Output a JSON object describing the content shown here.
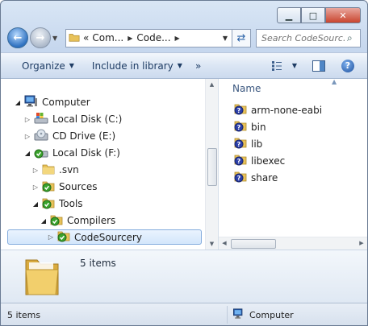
{
  "window": {
    "minimize_glyph": "▁",
    "maximize_glyph": "□",
    "close_glyph": "✕"
  },
  "nav": {
    "back_icon": "back-arrow-icon",
    "forward_icon": "forward-arrow-icon",
    "address": {
      "prefix": "«",
      "parts": [
        "Com...",
        "Code..."
      ]
    },
    "search_placeholder": "Search CodeSourc..."
  },
  "toolbar": {
    "organize": "Organize",
    "include_in_library": "Include in library",
    "overflow": "»"
  },
  "tree": {
    "items": [
      {
        "label": "Computer"
      },
      {
        "label": "Local Disk (C:)"
      },
      {
        "label": "CD Drive (E:)"
      },
      {
        "label": "Local Disk (F:)"
      },
      {
        "label": ".svn"
      },
      {
        "label": "Sources"
      },
      {
        "label": "Tools"
      },
      {
        "label": "Compilers"
      },
      {
        "label": "CodeSourcery"
      }
    ]
  },
  "files": {
    "column_name": "Name",
    "items": [
      {
        "label": "arm-none-eabi"
      },
      {
        "label": "bin"
      },
      {
        "label": "lib"
      },
      {
        "label": "libexec"
      },
      {
        "label": "share"
      }
    ]
  },
  "details": {
    "count": "5 items"
  },
  "status": {
    "left": "5 items",
    "location": "Computer"
  },
  "colors": {
    "folder": "#e8c25a",
    "selection_border": "#84acdd",
    "svn_check": "#3aa32c",
    "svn_unknown": "#2c3fa8"
  }
}
